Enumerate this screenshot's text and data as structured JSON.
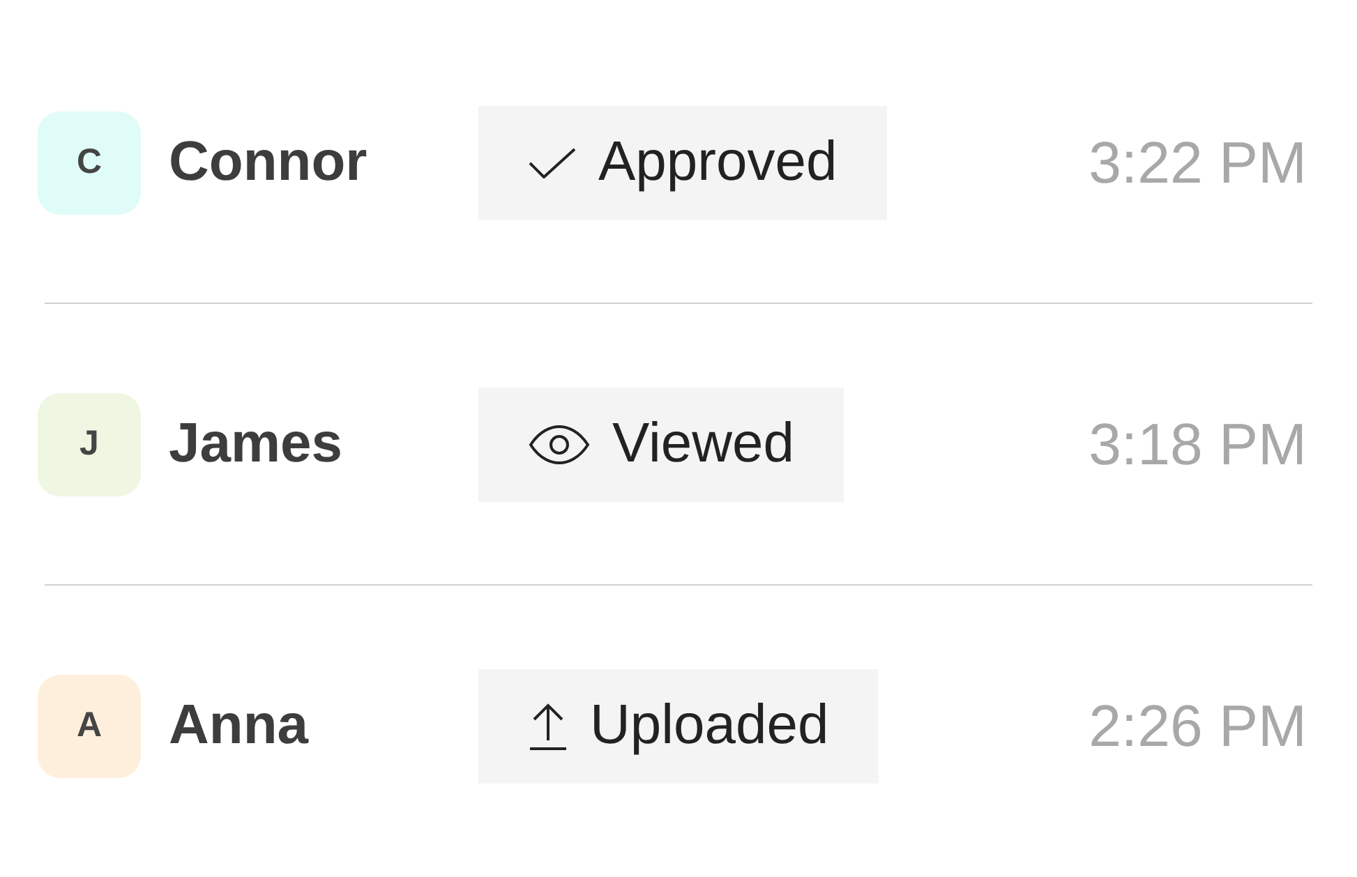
{
  "rows": [
    {
      "avatar": {
        "initial": "C",
        "color": "#e0fcf8"
      },
      "name": "Connor",
      "status": {
        "kind": "approved",
        "label": "Approved"
      },
      "time": "3:22 PM"
    },
    {
      "avatar": {
        "initial": "J",
        "color": "#eff6e2"
      },
      "name": "James",
      "status": {
        "kind": "viewed",
        "label": "Viewed"
      },
      "time": "3:18 PM"
    },
    {
      "avatar": {
        "initial": "A",
        "color": "#feefdc"
      },
      "name": "Anna",
      "status": {
        "kind": "uploaded",
        "label": "Uploaded"
      },
      "time": "2:26 PM"
    }
  ]
}
